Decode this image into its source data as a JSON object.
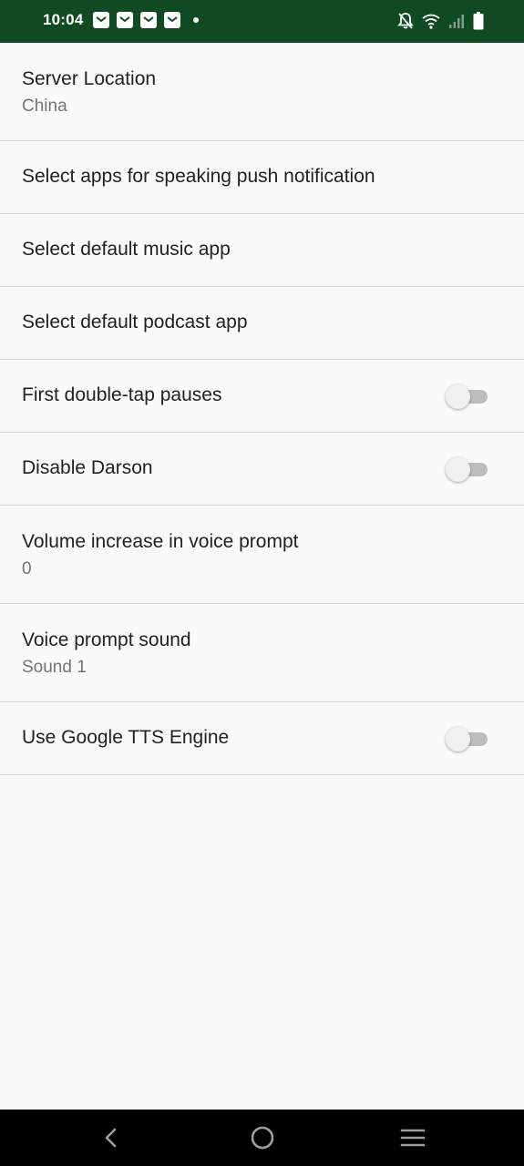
{
  "status_bar": {
    "time": "10:04",
    "background": "#104a22",
    "notification_icons": [
      "gmail-icon",
      "gmail-icon",
      "gmail-icon",
      "gmail-icon",
      "dot-icon"
    ],
    "system_icons": [
      "mute-bell-icon",
      "wifi-icon",
      "signal-icon",
      "battery-icon"
    ]
  },
  "preferences": [
    {
      "title": "Server Location",
      "summary": "China"
    },
    {
      "title": "Select apps for speaking push notification"
    },
    {
      "title": "Select default music app"
    },
    {
      "title": "Select default podcast app"
    },
    {
      "title": "First double-tap pauses",
      "switch_on": false
    },
    {
      "title": "Disable Darson",
      "switch_on": false
    },
    {
      "title": "Volume increase in voice prompt",
      "summary": "0"
    },
    {
      "title": "Voice prompt sound",
      "summary": "Sound 1"
    },
    {
      "title": "Use Google TTS Engine",
      "switch_on": false
    }
  ],
  "nav_bar": {
    "buttons": [
      "back-icon",
      "home-icon",
      "recents-icon"
    ]
  }
}
